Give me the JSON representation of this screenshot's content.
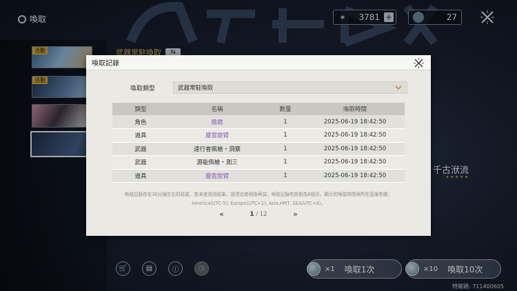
{
  "topbar": {
    "title": "喚取"
  },
  "currency": [
    {
      "icon": "star-crystal-icon",
      "value": "3781"
    },
    {
      "icon": "orb-ticket-icon",
      "value": "27"
    }
  ],
  "banners": [
    {
      "tag": "活動"
    },
    {
      "tag": "活動"
    },
    {
      "tag": ""
    },
    {
      "tag": ""
    }
  ],
  "background": {
    "banner_title": "武器常駐喚取",
    "right_name": "千古洑流",
    "right_stars": "✦✦✦✦✦"
  },
  "bottom": {
    "pull_one": {
      "count": "×1",
      "label": "喚取1次"
    },
    "pull_ten": {
      "count": "×10",
      "label": "喚取10次"
    },
    "uid": "特徵碼: 711400605"
  },
  "modal": {
    "title": "喚取記錄",
    "filter_label": "喚取類型",
    "filter_value": "武器常駐喚取",
    "columns": [
      "類型",
      "名稱",
      "數量",
      "喚取時間"
    ],
    "rows": [
      {
        "type": "角色",
        "name": "熾霞",
        "qty": "1",
        "time": "2025-06-19 18:42:50",
        "highlight": true
      },
      {
        "type": "道具",
        "name": "塵雲旋臂",
        "qty": "1",
        "time": "2025-06-19 18:42:50",
        "highlight": true
      },
      {
        "type": "武器",
        "name": "遠行者佩槍・洞察",
        "qty": "1",
        "time": "2025-06-19 18:42:50",
        "highlight": false
      },
      {
        "type": "武器",
        "name": "源能佩槍・測三",
        "qty": "1",
        "time": "2025-06-19 18:42:50",
        "highlight": false
      },
      {
        "type": "道具",
        "name": "塵雲旋臂",
        "qty": "1",
        "time": "2025-06-19 18:42:50",
        "highlight": true
      }
    ],
    "note_line1": "喚取記錄存在30分鐘左右的延遲，若未查詢到結果，請漂泊者稍後再試。喚取記錄有效期為6個月，顯示的喚取時間與所在區服有關：",
    "note_line2": "America(UTC-5); Europe(UTC+1); Asia,HMT, SEA(UTC+8)。",
    "page_current": "1",
    "page_total": "12",
    "highlight_color": "#8a5fb8"
  }
}
